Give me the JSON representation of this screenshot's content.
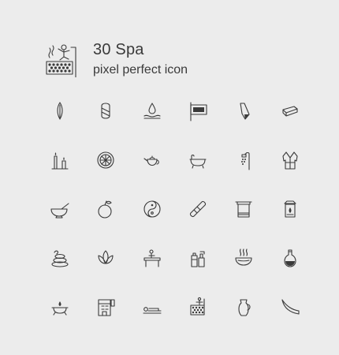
{
  "header": {
    "title": "30 Spa",
    "subtitle": "pixel perfect icon",
    "logo_icon": "sauna-icon"
  },
  "colors": {
    "background": "#ececec",
    "icon_stroke": "#3a3a3a"
  },
  "icons": [
    [
      "clove-icon",
      "rolled-towel-icon",
      "hand-water-drop-icon",
      "spa-sign-icon",
      "folded-towel-icon",
      "towel-stack-icon"
    ],
    [
      "candles-icon",
      "lemon-slice-icon",
      "teapot-icon",
      "bathtub-icon",
      "shower-icon",
      "bathrobe-icon"
    ],
    [
      "mortar-pestle-icon",
      "fruit-icon",
      "yin-yang-icon",
      "bamboo-roll-icon",
      "towel-rack-icon",
      "aroma-lamp-icon"
    ],
    [
      "hot-stones-icon",
      "lotus-icon",
      "massage-table-icon",
      "cosmetic-bottles-icon",
      "bowl-steam-icon",
      "oil-flask-icon"
    ],
    [
      "oil-burner-icon",
      "spa-building-icon",
      "lying-person-icon",
      "sauna-icon",
      "jug-icon",
      "hammock-icon"
    ]
  ]
}
